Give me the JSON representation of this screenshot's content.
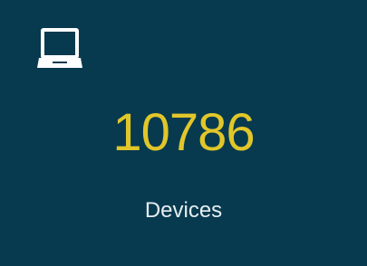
{
  "tile": {
    "icon": "laptop-icon",
    "count": "10786",
    "label": "Devices",
    "colors": {
      "background": "#073a4f",
      "count": "#e1c62a",
      "label": "#e7eef2",
      "icon": "#ffffff"
    }
  }
}
